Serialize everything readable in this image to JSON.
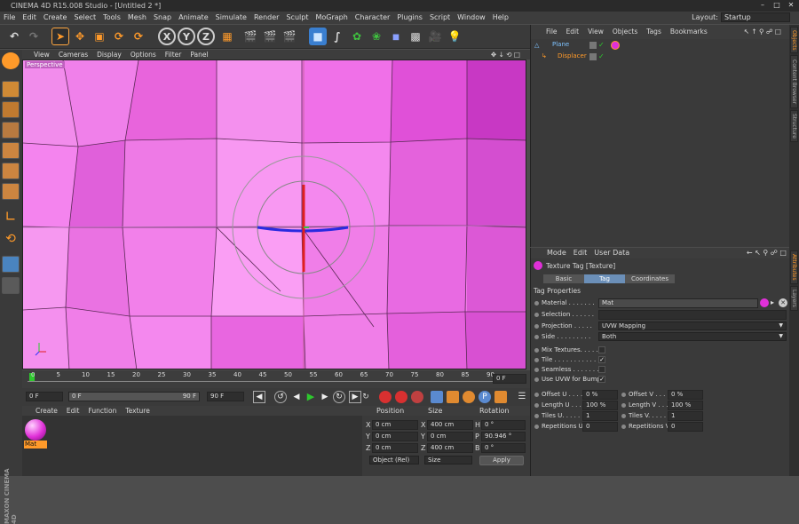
{
  "app": {
    "title": "CINEMA 4D R15.008 Studio - [Untitled 2 *]",
    "layout_label": "Layout:",
    "layout_value": "Startup"
  },
  "menu": [
    "File",
    "Edit",
    "Create",
    "Select",
    "Tools",
    "Mesh",
    "Snap",
    "Animate",
    "Simulate",
    "Render",
    "Sculpt",
    "MoGraph",
    "Character",
    "Plugins",
    "Script",
    "Window",
    "Help"
  ],
  "toolbar": {
    "axis_x": "X",
    "axis_y": "Y",
    "axis_z": "Z"
  },
  "viewport": {
    "menu": [
      "View",
      "Cameras",
      "Display",
      "Options",
      "Filter",
      "Panel"
    ],
    "label": "Perspective",
    "bg_color": "#f078e8"
  },
  "timeline": {
    "ticks": [
      "0",
      "5",
      "10",
      "15",
      "20",
      "25",
      "30",
      "35",
      "40",
      "45",
      "50",
      "55",
      "60",
      "65",
      "70",
      "75",
      "80",
      "85",
      "90"
    ],
    "current_frame": "0 F"
  },
  "playbar": {
    "start": "0 F",
    "range_start": "0 F",
    "range_end": "90 F",
    "end": "90 F"
  },
  "materials": {
    "menu": [
      "Create",
      "Edit",
      "Function",
      "Texture"
    ],
    "mat_name": "Mat",
    "brand_line1": "MAXON",
    "brand_line2": "CINEMA 4D"
  },
  "coords": {
    "headers": [
      "Position",
      "Size",
      "Rotation"
    ],
    "rows": [
      {
        "axis": "X",
        "pos": "0 cm",
        "size_axis": "X",
        "size": "400 cm",
        "rot_axis": "H",
        "rot": "0 °"
      },
      {
        "axis": "Y",
        "pos": "0 cm",
        "size_axis": "Y",
        "size": "0 cm",
        "rot_axis": "P",
        "rot": "90.946 °"
      },
      {
        "axis": "Z",
        "pos": "0 cm",
        "size_axis": "Z",
        "size": "400 cm",
        "rot_axis": "B",
        "rot": "0 °"
      }
    ],
    "mode": "Object (Rel)",
    "size_mode": "Size",
    "apply": "Apply"
  },
  "objects": {
    "menu": [
      "File",
      "Edit",
      "View",
      "Objects",
      "Tags",
      "Bookmarks"
    ],
    "items": [
      {
        "name": "Plane",
        "color": "#7fc3ff"
      },
      {
        "name": "Displacer",
        "color": "#ff9a2a"
      }
    ]
  },
  "attributes": {
    "menu": [
      "Mode",
      "Edit",
      "User Data"
    ],
    "title": "Texture Tag [Texture]",
    "tabs": [
      "Basic",
      "Tag",
      "Coordinates"
    ],
    "section": "Tag Properties",
    "material_label": "Material . . . . . . .",
    "material_value": "Mat",
    "selection_label": "Selection . . . . . .",
    "projection_label": "Projection . . . . .",
    "projection_value": "UVW Mapping",
    "side_label": "Side . . . . . . . . .",
    "side_value": "Both",
    "mix_label": "Mix Textures. . . . .",
    "tile_label": "Tile . . . . . . . . . . .",
    "seamless_label": "Seamless . . . . . . .",
    "uvw_label": "Use UVW for Bump",
    "check_mark": "✓",
    "offset_u_label": "Offset U . . . .",
    "offset_u": "0 %",
    "offset_v_label": "Offset V . . . .",
    "offset_v": "0 %",
    "length_u_label": "Length U . . . .",
    "length_u": "100 %",
    "length_v_label": "Length V . . . .",
    "length_v": "100 %",
    "tiles_u_label": "Tiles U. . . . . .",
    "tiles_u": "1",
    "tiles_v_label": "Tiles V. . . . . .",
    "tiles_v": "1",
    "rep_u_label": "Repetitions U",
    "rep_u": "0",
    "rep_v_label": "Repetitions V",
    "rep_v": "0"
  },
  "side_tabs": [
    "Objects",
    "Content Browser",
    "Structure",
    "Attributes",
    "Layers"
  ]
}
